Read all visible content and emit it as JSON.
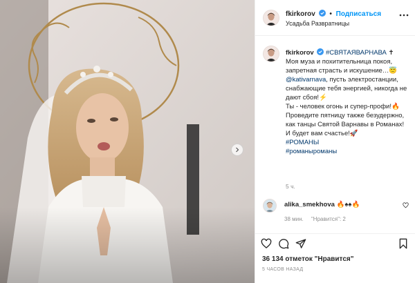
{
  "header": {
    "username": "fkirkorov",
    "dot": "•",
    "follow_label": "Подписаться",
    "location": "Усадьба Разврат­ницы"
  },
  "caption": {
    "username": "fkirkorov",
    "hashtag_main": "#СВЯТАЯВАРНАВА",
    "cross": "✝",
    "line1": "Моя муза и похитительница покоя, запретная страсть и искушение…😇",
    "mention": "@kativarnava",
    "line2": ", пусть электростанции, снабжающие тебя энергией, никогда не дают сбоя!⚡",
    "line3": "Ты - человек огонь и супер-профи!🔥",
    "line4": "Проведите пятницу также безудержно, как танцы Святой Варнавы в Романах! И будет вам счастье!🚀",
    "tag1": "#РОМАНЫ",
    "tag2": "#романыроманы",
    "age": "5 ч."
  },
  "comment": {
    "username": "alika_smekhova",
    "text": "🔥♠♠🔥",
    "age": "38 мин.",
    "likes": "\"Нравится\": 2"
  },
  "footer": {
    "likes_count": "36 134",
    "likes_word": "отметок",
    "likes_label": "\"Нравится\"",
    "date": "5 ЧАСОВ НАЗАД"
  },
  "colors": {
    "accent": "#0095f6",
    "hashtag": "#00376b",
    "muted": "#8e8e8e",
    "text": "#262626"
  },
  "icons": {
    "verified": "verified-badge-icon",
    "more": "more-options-icon",
    "heart": "heart-icon",
    "comment": "comment-icon",
    "share": "share-icon",
    "save": "bookmark-icon",
    "next": "chevron-right-icon"
  }
}
